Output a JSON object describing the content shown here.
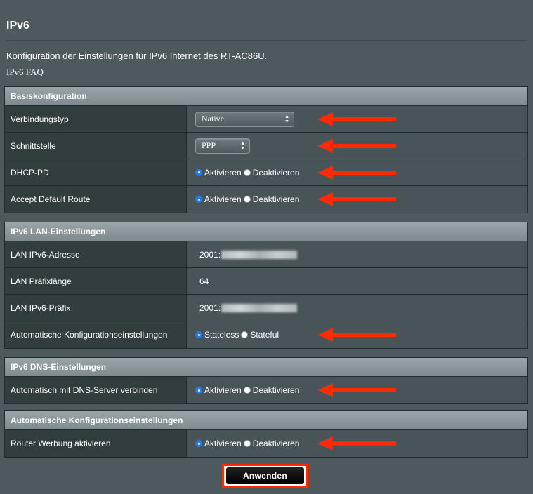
{
  "page": {
    "title": "IPv6",
    "intro": "Konfiguration der Einstellungen für IPv6 Internet des RT-AC86U.",
    "faq_link": "IPv6 FAQ"
  },
  "sections": {
    "basic": {
      "header": "Basiskonfiguration",
      "connection_type": {
        "label": "Verbindungstyp",
        "value": "Native"
      },
      "interface": {
        "label": "Schnittstelle",
        "value": "PPP"
      },
      "dhcp_pd": {
        "label": "DHCP-PD",
        "option_on": "Aktivieren",
        "option_off": "Deaktivieren",
        "selected": "Aktivieren"
      },
      "default_route": {
        "label": "Accept Default Route",
        "option_on": "Aktivieren",
        "option_off": "Deaktivieren",
        "selected": "Aktivieren"
      }
    },
    "lan": {
      "header": "IPv6 LAN-Einstellungen",
      "lan_address": {
        "label": "LAN IPv6-Adresse",
        "value_prefix": "2001:"
      },
      "prefix_length": {
        "label": "LAN Präfixlänge",
        "value": "64"
      },
      "lan_prefix": {
        "label": "LAN IPv6-Präfix",
        "value_prefix": "2001:"
      },
      "autoconfig": {
        "label": "Automatische Konfigurationseinstellungen",
        "option_a": "Stateless",
        "option_b": "Stateful",
        "selected": "Stateless"
      }
    },
    "dns": {
      "header": "IPv6 DNS-Einstellungen",
      "auto_dns": {
        "label": "Automatisch mit DNS-Server verbinden",
        "option_on": "Aktivieren",
        "option_off": "Deaktivieren",
        "selected": "Aktivieren"
      }
    },
    "autoconf": {
      "header": "Automatische Konfigurationseinstellungen",
      "router_adv": {
        "label": "Router Werbung aktivieren",
        "option_on": "Aktivieren",
        "option_off": "Deaktivieren",
        "selected": "Aktivieren"
      }
    }
  },
  "apply_label": "Anwenden",
  "colors": {
    "background": "#4d595d",
    "label_cell": "#323d3f",
    "value_cell": "#495459",
    "radio_checked": "#1a7cff",
    "annotation_red": "#ff2a00"
  },
  "icons": {
    "annotation": "red-arrow-icon",
    "select": "updown-chevron-icon"
  }
}
